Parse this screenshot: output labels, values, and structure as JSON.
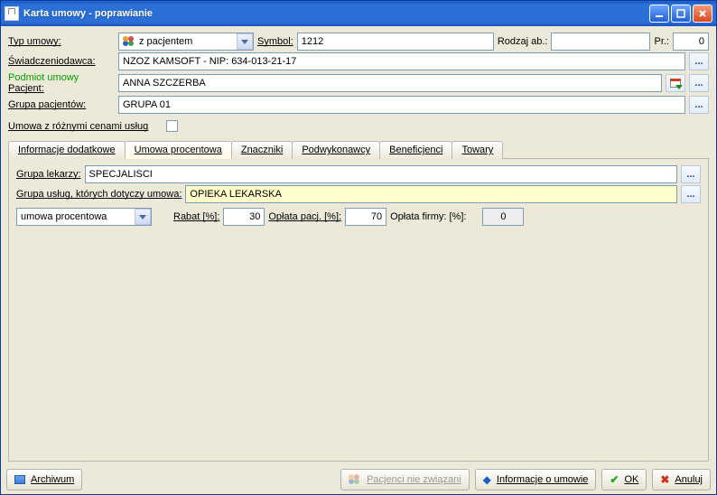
{
  "window": {
    "title": "Karta umowy - poprawianie"
  },
  "labels": {
    "typ_umowy": "Typ umowy:",
    "symbol": "Symbol:",
    "rodzaj_ab": "Rodzaj ab.:",
    "pr": "Pr.:",
    "swiadczeniodawca": "Świadczeniodawca:",
    "podmiot_umowy": "Podmiot umowy",
    "pacjent": "Pacjent:",
    "grupa_pacjentow": "Grupa pacjentów:",
    "umowa_rozne_ceny": "Umowa z różnymi cenami usług",
    "grupa_lekarzy": "Grupa lekarzy:",
    "grupa_uslug": "Grupa usług, których dotyczy umowa:",
    "rabat": "Rabat [%]:",
    "oplata_pacj": "Opłata pacj. [%]:",
    "oplata_firmy": "Opłata firmy: [%]:"
  },
  "fields": {
    "typ_umowy": "z pacjentem",
    "symbol": "1212",
    "rodzaj_ab": "",
    "pr": "0",
    "swiadczeniodawca": "NZOZ KAMSOFT - NIP: 634-013-21-17",
    "pacjent": "ANNA SZCZERBA",
    "grupa_pacjentow": "GRUPA 01",
    "umowa_rozne_ceny_checked": false,
    "grupa_lekarzy": "SPECJALIŚCI",
    "grupa_uslug": "OPIEKA LEKARSKA",
    "typ_umowy_proc": "umowa procentowa",
    "rabat": "30",
    "oplata_pacj": "70",
    "oplata_firmy": "0"
  },
  "tabs": [
    {
      "id": "info",
      "label": "Informacje dodatkowe",
      "active": false
    },
    {
      "id": "proc",
      "label": "Umowa procentowa",
      "active": true
    },
    {
      "id": "znacz",
      "label": "Znaczniki",
      "active": false
    },
    {
      "id": "podw",
      "label": "Podwykonawcy",
      "active": false
    },
    {
      "id": "benef",
      "label": "Beneficjenci",
      "active": false
    },
    {
      "id": "towary",
      "label": "Towary",
      "active": false
    }
  ],
  "footer": {
    "archiwum": "Archiwum",
    "pacjenci_nie_zwiazani": "Pacjenci nie związani",
    "informacje_o_umowie": "Informacje o umowie",
    "ok": "OK",
    "anuluj": "Anuluj"
  },
  "ellipsis": "..."
}
